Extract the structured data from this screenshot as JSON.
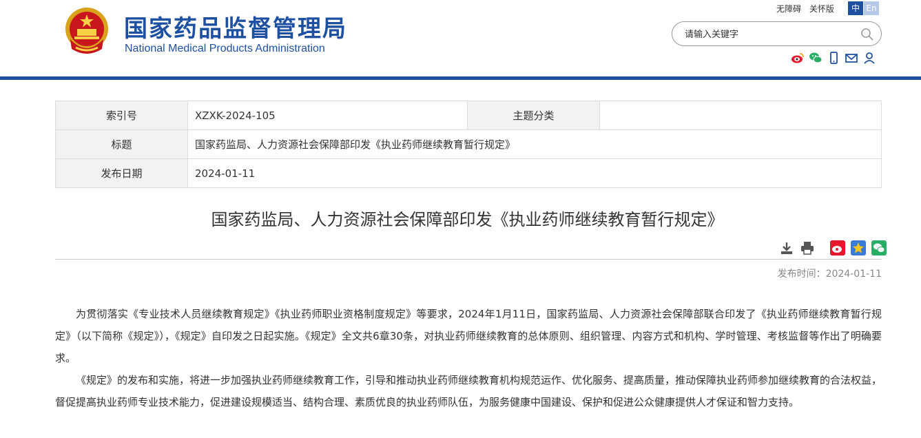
{
  "header": {
    "title_cn": "国家药品监督管理局",
    "title_en": "National Medical Products Administration",
    "accessibility": "无障碍",
    "close_edition": "关怀版",
    "lang_zh": "中",
    "lang_en": "En",
    "search_placeholder": "请输入关键字"
  },
  "info": {
    "index_label": "索引号",
    "index_value": "XZXK-2024-105",
    "category_label": "主题分类",
    "category_value": "",
    "title_label": "标题",
    "title_value": "国家药监局、人力资源社会保障部印发《执业药师继续教育暂行规定》",
    "date_label": "发布日期",
    "date_value": "2024-01-11"
  },
  "article": {
    "title": "国家药监局、人力资源社会保障部印发《执业药师继续教育暂行规定》",
    "pubtime": "发布时间：2024-01-11",
    "paragraphs": [
      "为贯彻落实《专业技术人员继续教育规定》《执业药师职业资格制度规定》等要求，2024年1月11日，国家药监局、人力资源社会保障部联合印发了《执业药师继续教育暂行规定》（以下简称《规定》），《规定》自印发之日起实施。《规定》全文共6章30条，对执业药师继续教育的总体原则、组织管理、内容方式和机构、学时管理、考核监督等作出了明确要求。",
      "《规定》的发布和实施，将进一步加强执业药师继续教育工作，引导和推动执业药师继续教育机构规范运作、优化服务、提高质量，推动保障执业药师参加继续教育的合法权益，督促提高执业药师专业技术能力，促进建设规模适当、结构合理、素质优良的执业药师队伍，为服务健康中国建设、保护和促进公众健康提供人才保证和智力支持。"
    ]
  },
  "colors": {
    "brand_blue": "#1e50a2",
    "weibo": "#e6162d",
    "wechat": "#2aae67",
    "gold": "#f5a623"
  },
  "icons": [
    "national-emblem",
    "search-icon",
    "weibo-icon",
    "wechat-icon",
    "mobile-icon",
    "mail-icon",
    "user-icon",
    "download-icon",
    "print-icon",
    "share-weibo-icon",
    "favorite-icon",
    "share-wechat-icon"
  ]
}
